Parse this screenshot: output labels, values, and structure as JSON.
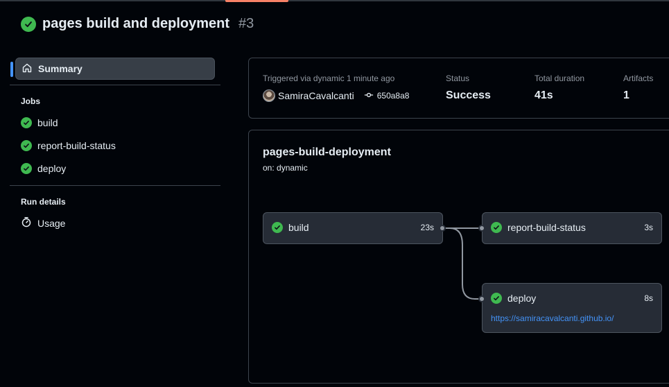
{
  "header": {
    "title": "pages build and deployment",
    "run_number": "#3"
  },
  "sidebar": {
    "summary_label": "Summary",
    "jobs_title": "Jobs",
    "jobs": [
      {
        "label": "build"
      },
      {
        "label": "report-build-status"
      },
      {
        "label": "deploy"
      }
    ],
    "run_details_title": "Run details",
    "usage_label": "Usage"
  },
  "summary": {
    "triggered": "Triggered via dynamic 1 minute ago",
    "actor": "SamiraCavalcanti",
    "commit": "650a8a8",
    "status_label": "Status",
    "status_value": "Success",
    "duration_label": "Total duration",
    "duration_value": "41s",
    "artifacts_label": "Artifacts",
    "artifacts_value": "1"
  },
  "workflow": {
    "name": "pages-build-deployment",
    "trigger": "on: dynamic",
    "jobs": {
      "build": {
        "name": "build",
        "duration": "23s"
      },
      "report": {
        "name": "report-build-status",
        "duration": "3s"
      },
      "deploy": {
        "name": "deploy",
        "duration": "8s",
        "url": "https://samiracavalcanti.github.io/"
      }
    }
  },
  "colors": {
    "success": "#3fb950",
    "link": "#4493f8",
    "accent": "#f78166"
  },
  "icons": [
    "check-circle-icon",
    "home-icon",
    "stopwatch-icon",
    "git-commit-icon"
  ]
}
